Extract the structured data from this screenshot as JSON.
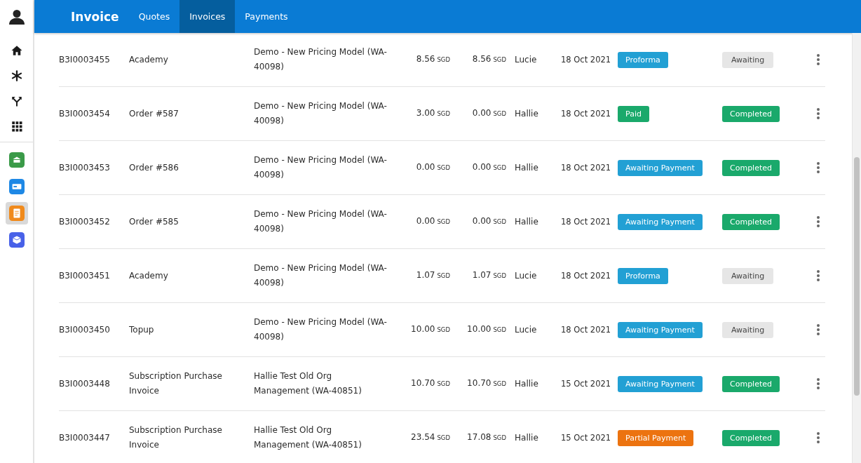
{
  "sidebar": {
    "items": [
      {
        "kind": "home",
        "selected": false
      },
      {
        "kind": "asterisk",
        "selected": false
      },
      {
        "kind": "fork",
        "selected": false
      },
      {
        "kind": "grid",
        "selected": false
      }
    ],
    "apps": [
      {
        "kind": "green",
        "selected": false
      },
      {
        "kind": "blue",
        "selected": false
      },
      {
        "kind": "orange",
        "selected": true
      },
      {
        "kind": "indigo",
        "selected": false
      }
    ]
  },
  "header": {
    "title": "Invoice",
    "tabs": [
      {
        "label": "Quotes",
        "selected": false
      },
      {
        "label": "Invoices",
        "selected": true
      },
      {
        "label": "Payments",
        "selected": false
      }
    ]
  },
  "table": {
    "rows": [
      {
        "number": "B3I0003455",
        "name": "Academy",
        "description": "Demo - New Pricing Model (WA-40098)",
        "amount": "8.56",
        "amount_currency": "SGD",
        "paid": "8.56",
        "paid_currency": "SGD",
        "owner": "Lucie",
        "date": "18 Oct 2021",
        "payment": {
          "label": "Proforma",
          "kind": "proforma"
        },
        "status": {
          "label": "Awaiting",
          "kind": "awaiting"
        }
      },
      {
        "number": "B3I0003454",
        "name": "Order #587",
        "description": "Demo - New Pricing Model (WA-40098)",
        "amount": "3.00",
        "amount_currency": "SGD",
        "paid": "0.00",
        "paid_currency": "SGD",
        "owner": "Hallie",
        "date": "18 Oct 2021",
        "payment": {
          "label": "Paid",
          "kind": "paid"
        },
        "status": {
          "label": "Completed",
          "kind": "completed"
        }
      },
      {
        "number": "B3I0003453",
        "name": "Order #586",
        "description": "Demo - New Pricing Model (WA-40098)",
        "amount": "0.00",
        "amount_currency": "SGD",
        "paid": "0.00",
        "paid_currency": "SGD",
        "owner": "Hallie",
        "date": "18 Oct 2021",
        "payment": {
          "label": "Awaiting Payment",
          "kind": "awaiting_payment"
        },
        "status": {
          "label": "Completed",
          "kind": "completed"
        }
      },
      {
        "number": "B3I0003452",
        "name": "Order #585",
        "description": "Demo - New Pricing Model (WA-40098)",
        "amount": "0.00",
        "amount_currency": "SGD",
        "paid": "0.00",
        "paid_currency": "SGD",
        "owner": "Hallie",
        "date": "18 Oct 2021",
        "payment": {
          "label": "Awaiting Payment",
          "kind": "awaiting_payment"
        },
        "status": {
          "label": "Completed",
          "kind": "completed"
        }
      },
      {
        "number": "B3I0003451",
        "name": "Academy",
        "description": "Demo - New Pricing Model (WA-40098)",
        "amount": "1.07",
        "amount_currency": "SGD",
        "paid": "1.07",
        "paid_currency": "SGD",
        "owner": "Lucie",
        "date": "18 Oct 2021",
        "payment": {
          "label": "Proforma",
          "kind": "proforma"
        },
        "status": {
          "label": "Awaiting",
          "kind": "awaiting"
        }
      },
      {
        "number": "B3I0003450",
        "name": "Topup",
        "description": "Demo - New Pricing Model (WA-40098)",
        "amount": "10.00",
        "amount_currency": "SGD",
        "paid": "10.00",
        "paid_currency": "SGD",
        "owner": "Lucie",
        "date": "18 Oct 2021",
        "payment": {
          "label": "Awaiting Payment",
          "kind": "awaiting_payment"
        },
        "status": {
          "label": "Awaiting",
          "kind": "awaiting"
        }
      },
      {
        "number": "B3I0003448",
        "name": "Subscription Purchase Invoice",
        "description": "Hallie Test Old Org Management (WA-40851)",
        "amount": "10.70",
        "amount_currency": "SGD",
        "paid": "10.70",
        "paid_currency": "SGD",
        "owner": "Hallie",
        "date": "15 Oct 2021",
        "payment": {
          "label": "Awaiting Payment",
          "kind": "awaiting_payment"
        },
        "status": {
          "label": "Completed",
          "kind": "completed"
        }
      },
      {
        "number": "B3I0003447",
        "name": "Subscription Purchase Invoice",
        "description": "Hallie Test Old Org Management (WA-40851)",
        "amount": "23.54",
        "amount_currency": "SGD",
        "paid": "17.08",
        "paid_currency": "SGD",
        "owner": "Hallie",
        "date": "15 Oct 2021",
        "payment": {
          "label": "Partial Payment",
          "kind": "partial"
        },
        "status": {
          "label": "Completed",
          "kind": "completed"
        }
      }
    ]
  }
}
